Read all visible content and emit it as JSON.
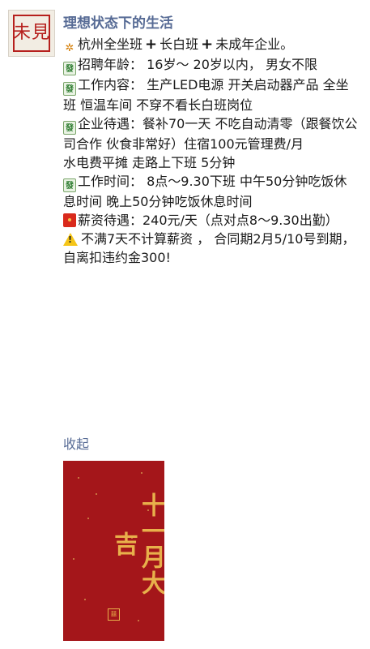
{
  "user": {
    "name": "理想状态下的生活",
    "avatar_glyph": "未見"
  },
  "post": {
    "line1_a": "杭州全坐班",
    "line1_b": "长白班",
    "line1_c": "未成年企业。",
    "age": "招聘年龄： 16岁～ 20岁以内， 男女不限",
    "work": "工作内容： 生产LED电源 开关启动器产品   全坐班 恒温车间   不穿不看长白班岗位",
    "benefits": "企业待遇：餐补70一天   不吃自动清零（跟餐饮公司合作  伙食非常好）住宿100元管理费/月",
    "utilities": "水电费平摊  走路上下班 5分钟",
    "hours": "工作时间： 8点～9.30下班   中午50分钟吃饭休息时间   晚上50分钟吃饭休息时间",
    "salary": "薪资待遇：240元/天（点对点8～9.30出勤）",
    "notice": "不满7天不计算薪资  ， 合同期2月5/10号到期，自离扣违约金300!"
  },
  "collapse_label": "收起",
  "poster": {
    "text": "十一月大吉"
  },
  "icons": {
    "party": "party-popper-icon",
    "plus": "heavy-plus-icon",
    "mahjong": "mahjong-tile-icon",
    "envelope": "red-envelope-icon",
    "warning": "warning-icon"
  },
  "colors": {
    "name_link": "#576b95",
    "poster_bg": "#a4161a",
    "poster_gold": "#e8b04b"
  }
}
